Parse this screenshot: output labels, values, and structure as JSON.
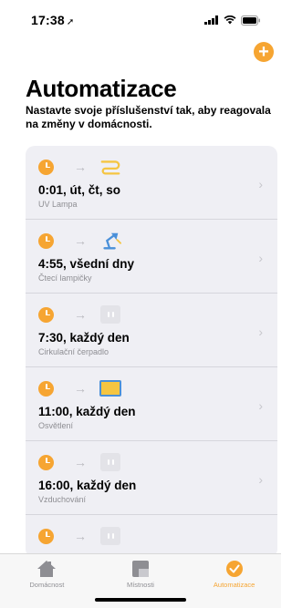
{
  "status": {
    "time": "17:38",
    "location_icon": "location-arrow-icon"
  },
  "header": {
    "add_icon": "plus-icon",
    "title": "Automatizace",
    "subtitle": "Nastavte svoje příslušenství tak, aby reagovala na změny v domácnosti."
  },
  "automations": [
    {
      "time": "0:01, út, čt, so",
      "accessory": "UV Lampa",
      "icon": "lamp-strip-icon"
    },
    {
      "time": "4:55, všední dny",
      "accessory": "Čtecí lampičky",
      "icon": "desk-lamp-icon"
    },
    {
      "time": "7:30, každý den",
      "accessory": "Cirkulační čerpadlo",
      "icon": "outlet-icon"
    },
    {
      "time": "11:00, každý den",
      "accessory": "Osvětlení",
      "icon": "light-panel-icon"
    },
    {
      "time": "16:00, každý den",
      "accessory": "Vzduchování",
      "icon": "outlet-icon"
    },
    {
      "time": "",
      "accessory": "",
      "icon": "outlet-icon"
    }
  ],
  "tabs": [
    {
      "label": "Domácnost",
      "icon": "house-icon",
      "active": false
    },
    {
      "label": "Místnosti",
      "icon": "rooms-icon",
      "active": false
    },
    {
      "label": "Automatizace",
      "icon": "automation-clock-icon",
      "active": true
    }
  ],
  "colors": {
    "accent": "#f6a532",
    "list_bg": "#efeff4",
    "blue": "#4a90d9"
  }
}
